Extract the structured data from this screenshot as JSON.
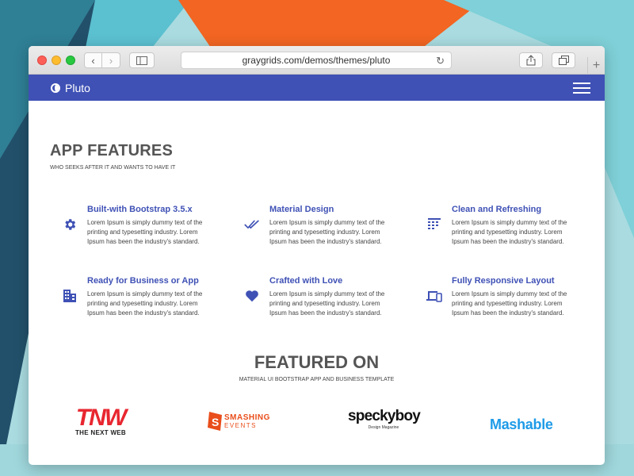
{
  "browser": {
    "url": "graygrids.com/demos/themes/pluto",
    "newtab_label": "+"
  },
  "app": {
    "brand": "Pluto"
  },
  "features_section": {
    "title": "APP FEATURES",
    "subtitle": "WHO SEEKS AFTER IT AND WANTS TO HAVE IT",
    "items": [
      {
        "title": "Built-with Bootstrap 3.5.x",
        "text": "Lorem Ipsum is simply dummy text of the printing and typesetting industry. Lorem Ipsum has been the industry's standard.",
        "icon": "gear-icon"
      },
      {
        "title": "Material Design",
        "text": "Lorem Ipsum is simply dummy text of the printing and typesetting industry. Lorem Ipsum has been the industry's standard.",
        "icon": "double-check-icon"
      },
      {
        "title": "Clean and Refreshing",
        "text": "Lorem Ipsum is simply dummy text of the printing and typesetting industry. Lorem Ipsum has been the industry's standard.",
        "icon": "grid-list-icon"
      },
      {
        "title": "Ready for Business or App",
        "text": "Lorem Ipsum is simply dummy text of the printing and typesetting industry. Lorem Ipsum has been the industry's standard.",
        "icon": "building-icon"
      },
      {
        "title": "Crafted with Love",
        "text": "Lorem Ipsum is simply dummy text of the printing and typesetting industry. Lorem Ipsum has been the industry's standard.",
        "icon": "heart-icon"
      },
      {
        "title": "Fully Responsive Layout",
        "text": "Lorem Ipsum is simply dummy text of the printing and typesetting industry. Lorem Ipsum has been the industry's standard.",
        "icon": "devices-icon"
      }
    ]
  },
  "featured_section": {
    "title": "FEATURED ON",
    "subtitle": "MATERIAL UI BOOTSTRAP APP AND BUSINESS TEMPLATE",
    "logos": {
      "tnw": {
        "main": "TNW",
        "tagline": "THE NEXT WEB"
      },
      "smashing": {
        "main": "SMASHING",
        "tagline": "EVENTS"
      },
      "speckyboy": {
        "main": "speckyboy",
        "tagline": "Design Magazine"
      },
      "mashable": {
        "main": "Mashable"
      }
    }
  },
  "colors": {
    "primary": "#3f51b5",
    "heading": "#555555",
    "background_teal": "#5fb3c7",
    "background_orange": "#f26522"
  }
}
